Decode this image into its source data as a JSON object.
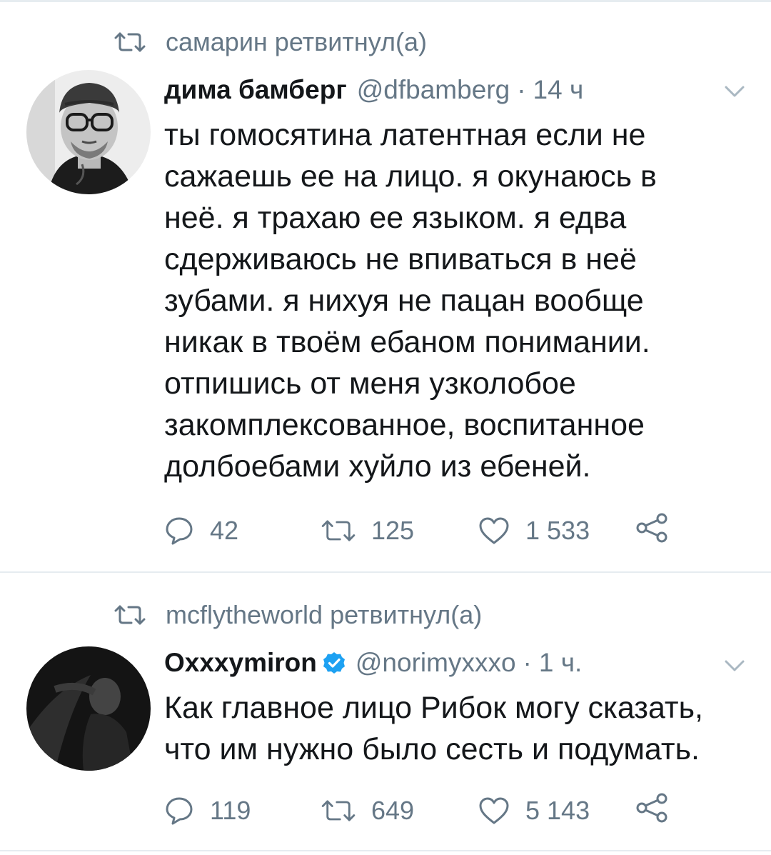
{
  "colors": {
    "text": "#14171a",
    "secondary": "#657786",
    "divider": "#e6ecf0",
    "verified": "#1da1f2"
  },
  "tweets": [
    {
      "retweeted_by": "самарин ретвитнул(а)",
      "author_name": "дима бамберг",
      "handle": "@dfbamberg",
      "separator": "·",
      "time": "14 ч",
      "verified": false,
      "text_lines": [
        "ты гомосятина латентная если не",
        "сажаешь ее на лицо. я окунаюсь в",
        "неё. я трахаю ее языком. я едва",
        "сдерживаюсь не впиваться в неё",
        "зубами. я нихуя не пацан вообще",
        "никак в твоём ебаном понимании.",
        "отпишись от меня узколобое",
        "закомплексованное, воспитанное",
        "долбоебами хуйло из ебеней."
      ],
      "replies": "42",
      "retweets": "125",
      "likes": "1 533",
      "icons": [
        "retweet-icon",
        "avatar",
        "chevron-down-icon",
        "reply-icon",
        "retweet-icon",
        "heart-icon",
        "share-icon"
      ]
    },
    {
      "retweeted_by": "mcflytheworld ретвитнул(а)",
      "author_name": "Oxxxymiron",
      "handle": "@norimyxxxo",
      "separator": "·",
      "time": "1 ч.",
      "verified": true,
      "text_lines": [
        "Как главное лицо Рибок могу сказать,",
        "что им нужно было сесть и подумать."
      ],
      "replies": "119",
      "retweets": "649",
      "likes": "5 143",
      "icons": [
        "retweet-icon",
        "avatar",
        "verified-icon",
        "chevron-down-icon",
        "reply-icon",
        "retweet-icon",
        "heart-icon",
        "share-icon"
      ]
    }
  ]
}
